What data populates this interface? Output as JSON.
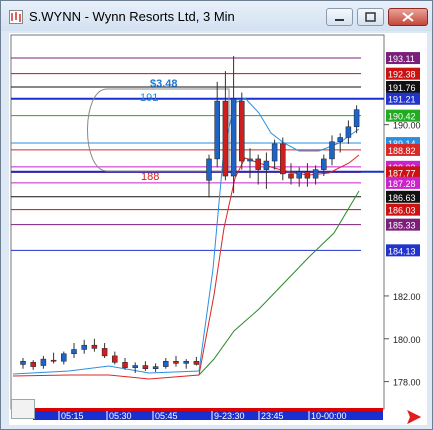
{
  "window": {
    "title": "S.WYNN - Wynn Resorts Ltd, 3 Min",
    "controls": [
      "minimize",
      "maximize",
      "close"
    ]
  },
  "colors": {
    "background": "#ffffff",
    "candle_up": "#1e64c8",
    "candle_down": "#cc2020",
    "ema_fast": "#2a8fe0",
    "ema_mid": "#d82828",
    "ema_slow": "#2a8a2a",
    "time_axis": "#1a2fd0",
    "time_axis_red": "#dd0000"
  },
  "annotations": {
    "box_label": "$3.48",
    "box_high_label": "191",
    "box_low_label": "188"
  },
  "chart_data": {
    "type": "candlestick",
    "ylim": [
      177.0,
      194.0
    ],
    "y_ticks": [
      "190.00",
      "182.00",
      "180.00",
      "178.00"
    ],
    "x_ticks": [
      "05:15",
      "05:30",
      "05:45",
      "9-23:30",
      "23:45",
      "10-00:00"
    ],
    "price_levels": [
      {
        "value": 193.11,
        "label": "193.11",
        "color": "#7b1f7b"
      },
      {
        "value": 192.38,
        "label": "192.38",
        "color": "#cc1111"
      },
      {
        "value": 191.76,
        "label": "191.76",
        "color": "#111111"
      },
      {
        "value": 191.21,
        "label": "191.21",
        "color": "#2233cc"
      },
      {
        "value": 190.42,
        "label": "190.42",
        "color": "#22aa22"
      },
      {
        "value": 189.14,
        "label": "189.14",
        "color": "#2a8fe0"
      },
      {
        "value": 188.82,
        "label": "188.82",
        "color": "#d82828"
      },
      {
        "value": 188.03,
        "label": "188.03",
        "color": "#cc22cc"
      },
      {
        "value": 187.77,
        "label": "187.77",
        "color": "#cc1111"
      },
      {
        "value": 187.28,
        "label": "187.28",
        "color": "#cc22cc"
      },
      {
        "value": 186.63,
        "label": "186.63",
        "color": "#111111"
      },
      {
        "value": 186.03,
        "label": "186.03",
        "color": "#cc1111"
      },
      {
        "value": 185.33,
        "label": "185.33",
        "color": "#7b1f7b"
      },
      {
        "value": 184.13,
        "label": "184.13",
        "color": "#2233cc"
      }
    ],
    "candles_early": [
      {
        "o": 178.8,
        "h": 179.1,
        "l": 178.6,
        "c": 178.95
      },
      {
        "o": 178.9,
        "h": 179.0,
        "l": 178.55,
        "c": 178.7
      },
      {
        "o": 178.75,
        "h": 179.2,
        "l": 178.6,
        "c": 179.05
      },
      {
        "o": 179.0,
        "h": 179.35,
        "l": 178.85,
        "c": 178.95
      },
      {
        "o": 178.95,
        "h": 179.4,
        "l": 178.8,
        "c": 179.3
      },
      {
        "o": 179.3,
        "h": 179.8,
        "l": 179.1,
        "c": 179.5
      },
      {
        "o": 179.5,
        "h": 179.95,
        "l": 179.3,
        "c": 179.7
      },
      {
        "o": 179.7,
        "h": 180.0,
        "l": 179.4,
        "c": 179.55
      },
      {
        "o": 179.55,
        "h": 179.8,
        "l": 179.1,
        "c": 179.2
      },
      {
        "o": 179.2,
        "h": 179.4,
        "l": 178.8,
        "c": 178.9
      },
      {
        "o": 178.9,
        "h": 179.1,
        "l": 178.55,
        "c": 178.65
      },
      {
        "o": 178.65,
        "h": 178.9,
        "l": 178.4,
        "c": 178.75
      },
      {
        "o": 178.75,
        "h": 178.95,
        "l": 178.5,
        "c": 178.6
      },
      {
        "o": 178.6,
        "h": 178.85,
        "l": 178.45,
        "c": 178.7
      },
      {
        "o": 178.7,
        "h": 179.1,
        "l": 178.6,
        "c": 178.95
      },
      {
        "o": 178.95,
        "h": 179.2,
        "l": 178.7,
        "c": 178.85
      },
      {
        "o": 178.85,
        "h": 179.05,
        "l": 178.6,
        "c": 178.95
      },
      {
        "o": 178.95,
        "h": 179.15,
        "l": 178.75,
        "c": 178.8
      }
    ],
    "candles_late": [
      {
        "o": 187.4,
        "h": 188.6,
        "l": 186.6,
        "c": 188.4
      },
      {
        "o": 188.4,
        "h": 192.0,
        "l": 188.0,
        "c": 191.1
      },
      {
        "o": 191.1,
        "h": 192.5,
        "l": 187.4,
        "c": 187.6
      },
      {
        "o": 187.6,
        "h": 193.2,
        "l": 186.8,
        "c": 191.2
      },
      {
        "o": 191.1,
        "h": 191.5,
        "l": 187.9,
        "c": 188.3
      },
      {
        "o": 188.3,
        "h": 188.9,
        "l": 187.5,
        "c": 188.4
      },
      {
        "o": 188.4,
        "h": 188.6,
        "l": 187.2,
        "c": 187.9
      },
      {
        "o": 187.9,
        "h": 188.7,
        "l": 187.0,
        "c": 188.3
      },
      {
        "o": 188.3,
        "h": 189.3,
        "l": 187.9,
        "c": 189.1
      },
      {
        "o": 189.1,
        "h": 189.4,
        "l": 187.4,
        "c": 187.7
      },
      {
        "o": 187.7,
        "h": 188.2,
        "l": 187.2,
        "c": 187.5
      },
      {
        "o": 187.5,
        "h": 188.0,
        "l": 187.1,
        "c": 187.8
      },
      {
        "o": 187.8,
        "h": 188.2,
        "l": 187.1,
        "c": 187.5
      },
      {
        "o": 187.5,
        "h": 188.1,
        "l": 187.2,
        "c": 187.9
      },
      {
        "o": 187.9,
        "h": 188.6,
        "l": 187.6,
        "c": 188.4
      },
      {
        "o": 188.4,
        "h": 189.5,
        "l": 188.1,
        "c": 189.2
      },
      {
        "o": 189.2,
        "h": 189.6,
        "l": 188.7,
        "c": 189.4
      },
      {
        "o": 189.4,
        "h": 190.2,
        "l": 189.1,
        "c": 189.9
      },
      {
        "o": 189.9,
        "h": 190.9,
        "l": 189.6,
        "c": 190.7
      }
    ]
  }
}
